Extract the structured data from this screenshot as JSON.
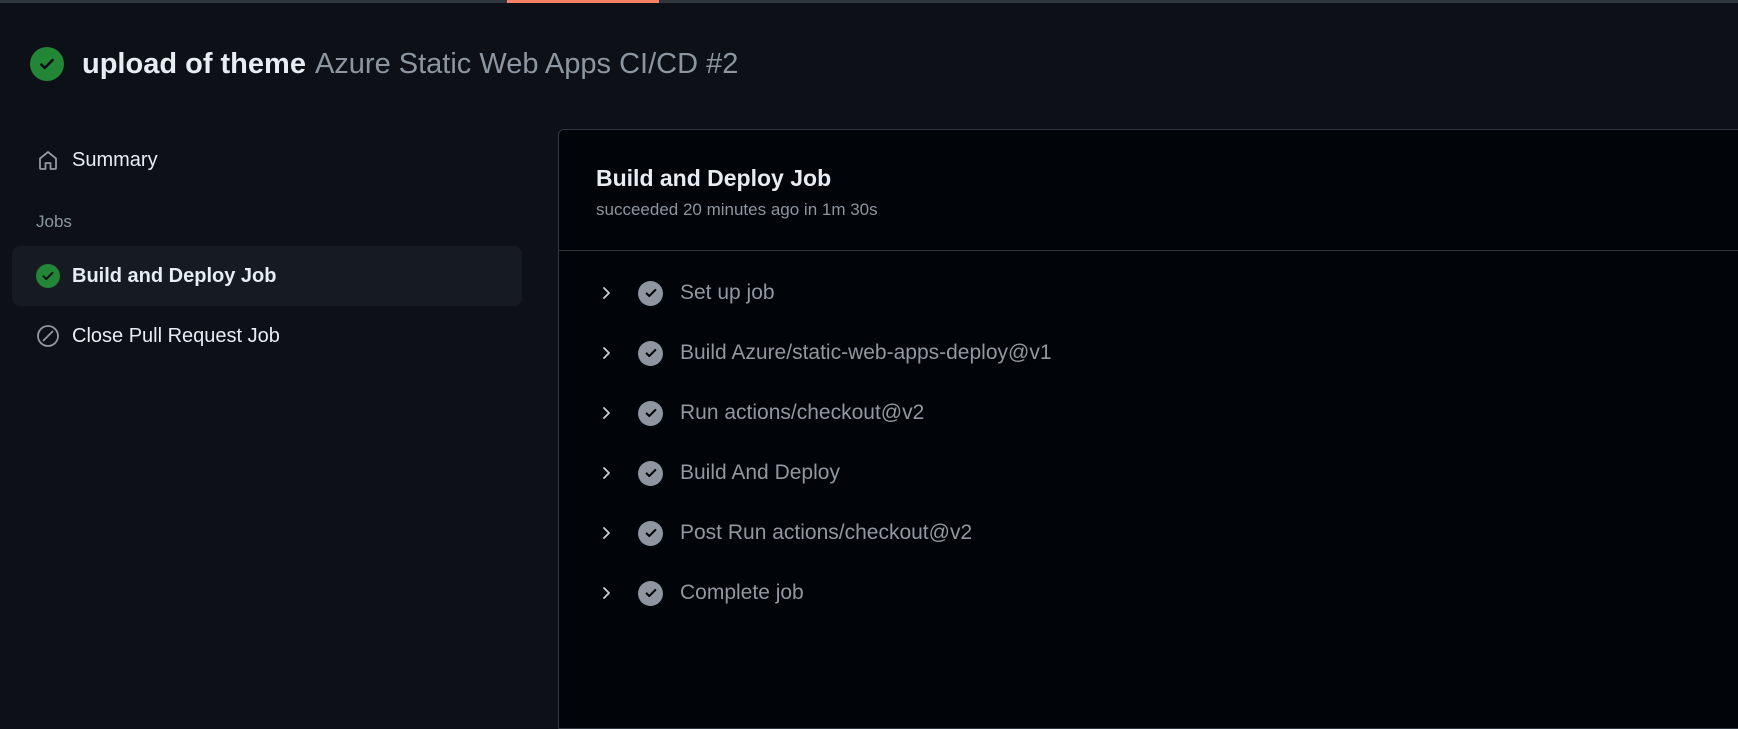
{
  "header": {
    "commit_title": "upload of theme",
    "workflow_name": "Azure Static Web Apps CI/CD #2"
  },
  "sidebar": {
    "summary_label": "Summary",
    "jobs_section_label": "Jobs",
    "jobs": [
      {
        "label": "Build and Deploy Job",
        "status": "success",
        "active": true
      },
      {
        "label": "Close Pull Request Job",
        "status": "skipped",
        "active": false
      }
    ]
  },
  "job_panel": {
    "title": "Build and Deploy Job",
    "subtitle": "succeeded 20 minutes ago in 1m 30s",
    "steps": [
      {
        "label": "Set up job"
      },
      {
        "label": "Build Azure/static-web-apps-deploy@v1"
      },
      {
        "label": "Run actions/checkout@v2"
      },
      {
        "label": "Build And Deploy"
      },
      {
        "label": "Post Run actions/checkout@v2"
      },
      {
        "label": "Complete job"
      }
    ]
  },
  "colors": {
    "background": "#0d1117",
    "panel": "#010409",
    "success": "#238636",
    "accent": "#f78166",
    "muted": "#8d96a0"
  }
}
